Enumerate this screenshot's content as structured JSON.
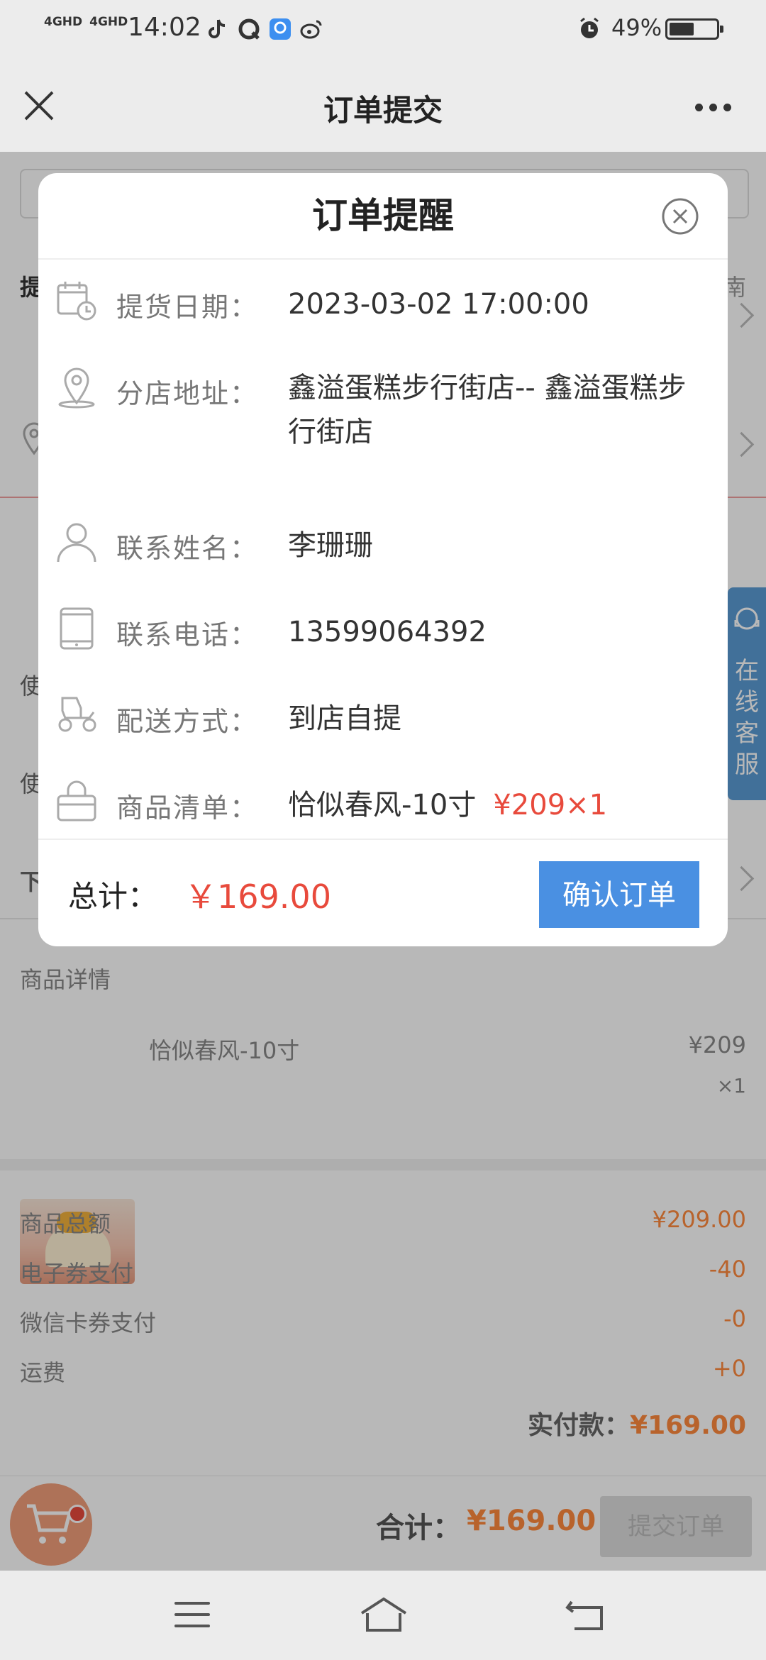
{
  "status": {
    "net1": "4GHD",
    "net2": "4GHD",
    "time": "14:02",
    "battery": "49%"
  },
  "nav": {
    "title": "订单提交"
  },
  "bg": {
    "row1_left": "提",
    "row1_right": "南",
    "row_use1": "使",
    "row_use2": "使",
    "row_down": "下",
    "detail_title": "商品详情",
    "item_name": "恰似春风-10寸",
    "item_price": "¥209",
    "item_qty": "×1",
    "summary": [
      {
        "label": "商品总额",
        "value": "¥209.00"
      },
      {
        "label": "电子券支付",
        "value": "-40"
      },
      {
        "label": "微信卡券支付",
        "value": "-0"
      },
      {
        "label": "运费",
        "value": "+0"
      }
    ],
    "paid_label": "实付款：",
    "paid_value": "¥169.00",
    "sum_label": "合计：",
    "sum_value": "¥169.00",
    "submit_label": "提交订单",
    "cs_chars": [
      "在",
      "线",
      "客",
      "服"
    ]
  },
  "dialog": {
    "title": "订单提醒",
    "rows": [
      {
        "label": "提货日期：",
        "value": "2023-03-02 17:00:00",
        "icon": "calendar-clock-icon"
      },
      {
        "label": "分店地址：",
        "value": "鑫溢蛋糕步行街店-- 鑫溢蛋糕步行街店",
        "icon": "location-pin-icon"
      },
      {
        "label": "联系姓名：",
        "value": "李珊珊",
        "icon": "person-icon"
      },
      {
        "label": "联系电话：",
        "value": "13599064392",
        "icon": "tablet-icon"
      },
      {
        "label": "配送方式：",
        "value": "到店自提",
        "icon": "scooter-icon"
      },
      {
        "label": "商品清单：",
        "value": "恰似春风-10寸",
        "icon": "shopping-bag-icon"
      }
    ],
    "item_price": "¥209×1",
    "total_label": "总计：",
    "total_value": "￥169.00",
    "confirm_label": "确认订单"
  }
}
